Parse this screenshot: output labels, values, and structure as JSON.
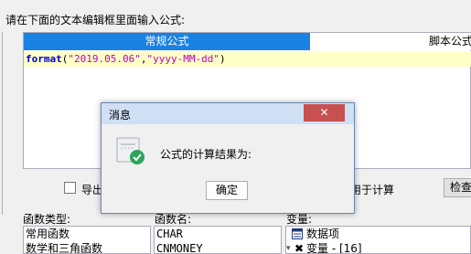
{
  "prompt": "请在下面的文本编辑框里面输入公式:",
  "tabs": {
    "active": "常规公式",
    "other": "脚本公式"
  },
  "formula": {
    "fn": "format",
    "open": "(",
    "arg1": "\"2019.05.06\"",
    "comma": ",",
    "arg2": "\"yyyy-MM-dd\"",
    "close": ")"
  },
  "options": {
    "export_label": "导出",
    "use_label": "用于计算",
    "check_button": "检查"
  },
  "function_type": {
    "label": "函数类型:",
    "items": [
      "常用函数",
      "数学和三角函数"
    ]
  },
  "function_names": {
    "label": "函数名:",
    "items": [
      "CHAR",
      "CNMONEY"
    ]
  },
  "variables": {
    "label": "变量:",
    "items": [
      "数据项",
      "变量 - [16]"
    ]
  },
  "dialog": {
    "title": "消息",
    "close": "✕",
    "message": "公式的计算结果为:",
    "ok": "确定"
  }
}
